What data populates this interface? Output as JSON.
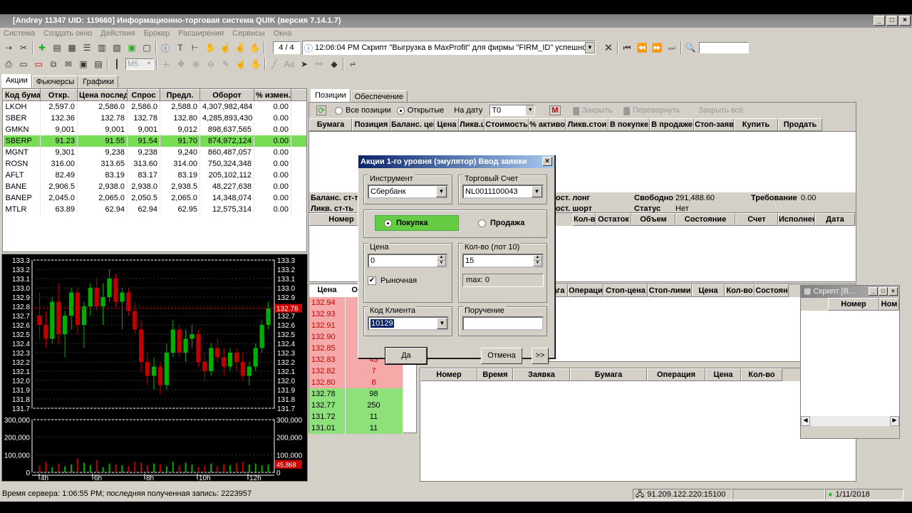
{
  "window": {
    "title": "[Andrey 11347 UID: 119660] Информационно-торговая система QUIK (версия 7.14.1.7)"
  },
  "menu": [
    "Система",
    "Создать окно",
    "Действия",
    "Брокер",
    "Расширения",
    "Сервисы",
    "Окна"
  ],
  "toolbar": {
    "counter": "4 / 4",
    "message": "12:06:04 PM  Скрипт \"Выгрузка в MaxProfit\" для фирмы \"FIRM_ID\" успешно за",
    "interval": "M5",
    "search_value": ""
  },
  "left_tabs": [
    "Акции",
    "Фьючерсы",
    "Графики"
  ],
  "quotes": {
    "headers": [
      "Код бума",
      "Откр.",
      "Цена послед",
      "Спрос",
      "Предл.",
      "Оборот",
      "% измен."
    ],
    "rows": [
      [
        "LKOH",
        "2,597.0",
        "2,586.0",
        "2,586.0",
        "2,588.0",
        "4,307,982,484",
        "0.00"
      ],
      [
        "SBER",
        "132.36",
        "132.78",
        "132.78",
        "132.80",
        "4,285,893,430",
        "0.00"
      ],
      [
        "GMKN",
        "9,001",
        "9,001",
        "9,001",
        "9,012",
        "898,637,565",
        "0.00"
      ],
      [
        "SBERP",
        "91.23",
        "91.55",
        "91.54",
        "91.70",
        "874,972,124",
        "0.00"
      ],
      [
        "MGNT",
        "9,301",
        "9,238",
        "9,238",
        "9,240",
        "860,487,057",
        "0.00"
      ],
      [
        "ROSN",
        "316.00",
        "313.65",
        "313.60",
        "314.00",
        "750,324,348",
        "0.00"
      ],
      [
        "AFLT",
        "82.49",
        "83.19",
        "83.17",
        "83.19",
        "205,102,112",
        "0.00"
      ],
      [
        "BANE",
        "2,906.5",
        "2,938.0",
        "2,938.0",
        "2,938.5",
        "48,227,638",
        "0.00"
      ],
      [
        "BANEP",
        "2,045.0",
        "2,065.0",
        "2,050.5",
        "2,065.0",
        "14,348,074",
        "0.00"
      ],
      [
        "MTLR",
        "63.89",
        "62.94",
        "62.94",
        "62.95",
        "12,575,314",
        "0.00"
      ]
    ],
    "selected_row": 3
  },
  "chart_data": {
    "type": "candlestick",
    "price_ticks": [
      "133.3",
      "133.2",
      "133.1",
      "133.0",
      "132.9",
      "132.8",
      "132.7",
      "132.6",
      "132.5",
      "132.4",
      "132.3",
      "132.2",
      "132.1",
      "132.0",
      "131.9",
      "131.8",
      "131.7"
    ],
    "price_range": [
      131.7,
      133.3
    ],
    "current_price_label": "132.78",
    "volume_ticks": [
      "300,000",
      "200,000",
      "100,000",
      "0"
    ],
    "volume_label": "45,868",
    "time_ticks": [
      "4h",
      "6h",
      "8h",
      "10h",
      "12h"
    ],
    "candles": [
      [
        132.7,
        132.95,
        132.45,
        132.6
      ],
      [
        132.6,
        132.75,
        132.35,
        132.45
      ],
      [
        132.45,
        132.9,
        132.4,
        132.85
      ],
      [
        132.85,
        133.05,
        132.4,
        132.5
      ],
      [
        132.5,
        132.75,
        132.25,
        132.7
      ],
      [
        132.7,
        133.0,
        132.55,
        132.95
      ],
      [
        132.95,
        133.0,
        132.5,
        132.6
      ],
      [
        132.6,
        132.85,
        132.35,
        132.8
      ],
      [
        132.8,
        133.05,
        132.7,
        133.0
      ],
      [
        133.0,
        133.1,
        132.75,
        132.8
      ],
      [
        132.8,
        133.05,
        132.6,
        132.9
      ],
      [
        132.9,
        133.2,
        132.85,
        133.1
      ],
      [
        133.1,
        133.15,
        132.8,
        132.85
      ],
      [
        132.85,
        133.0,
        132.55,
        132.95
      ],
      [
        132.95,
        133.0,
        132.7,
        132.75
      ],
      [
        132.75,
        132.85,
        132.5,
        132.55
      ],
      [
        132.55,
        132.65,
        132.1,
        132.2
      ],
      [
        132.2,
        132.3,
        131.95,
        132.05
      ],
      [
        132.05,
        132.25,
        131.9,
        132.15
      ],
      [
        132.15,
        132.2,
        131.85,
        131.95
      ],
      [
        131.95,
        132.4,
        131.9,
        132.3
      ],
      [
        132.3,
        132.65,
        132.25,
        132.55
      ],
      [
        132.55,
        132.6,
        132.25,
        132.3
      ],
      [
        132.3,
        132.55,
        132.2,
        132.45
      ],
      [
        132.45,
        132.6,
        132.35,
        132.5
      ],
      [
        132.5,
        132.55,
        132.15,
        132.2
      ],
      [
        132.2,
        132.3,
        132.0,
        132.1
      ],
      [
        132.1,
        132.4,
        132.05,
        132.35
      ],
      [
        132.35,
        132.45,
        132.2,
        132.25
      ],
      [
        132.25,
        132.35,
        132.05,
        132.15
      ],
      [
        132.15,
        132.35,
        132.1,
        132.3
      ],
      [
        132.3,
        132.35,
        132.1,
        132.2
      ],
      [
        132.2,
        132.3,
        132.0,
        132.05
      ],
      [
        132.05,
        132.2,
        131.95,
        132.15
      ],
      [
        132.15,
        132.4,
        132.1,
        132.35
      ],
      [
        132.35,
        132.65,
        132.3,
        132.6
      ],
      [
        132.6,
        132.85,
        132.55,
        132.78
      ]
    ],
    "volumes": [
      40000,
      60000,
      30000,
      50000,
      35000,
      45000,
      80000,
      55000,
      40000,
      70000,
      30000,
      50000,
      45000,
      40000,
      35000,
      60000,
      55000,
      40000,
      50000,
      45000,
      35000,
      60000,
      40000,
      55000,
      45000,
      30000,
      40000,
      50000,
      35000,
      45000,
      40000,
      55000,
      60000,
      45000,
      50000,
      40000,
      45868
    ]
  },
  "right_tabs": [
    "Позиции",
    "Обеспечение"
  ],
  "positions": {
    "filter": {
      "all_label": "Все позиции",
      "open_label": "Открытые",
      "date_label": "На дату",
      "date_value": "T0",
      "close_label": "Закрыть",
      "flip_label": "Перевернуть",
      "close_all_label": "Закрыть всё"
    },
    "headers": [
      "Бумага",
      "Позиция",
      "Баланс. цен",
      "Цена",
      "Ликв.ц",
      "Стоимость",
      "% активов",
      "Ликв.стои",
      "В покупке",
      "В продаже",
      "Стоп-заяв",
      "Купить",
      "Продать"
    ],
    "summary": {
      "balance_label": "Баланс. ст-ть",
      "liq_label": "Ликв. ст-ть",
      "long_label": "ост. лонг",
      "short_label": "ост. шорт",
      "free_label": "Свободно",
      "free_value": "291,488.60",
      "status_label": "Статус",
      "status_value": "Нет",
      "req_label": "Требование",
      "req_value": "0.00"
    }
  },
  "orders": {
    "headers": [
      "Номер",
      "Кол-во",
      "Остаток",
      "Объем",
      "Состояние",
      "Счет",
      "Исполнен",
      "Дата"
    ]
  },
  "orderbook": {
    "headers": [
      "Цена",
      "Об"
    ],
    "asks": [
      [
        "132.94",
        ""
      ],
      [
        "132.93",
        ""
      ],
      [
        "132.91",
        ""
      ],
      [
        "132.90",
        ""
      ],
      [
        "132.85",
        ""
      ],
      [
        "132.83",
        "43"
      ],
      [
        "132.82",
        "7"
      ],
      [
        "132.80",
        "8"
      ]
    ],
    "bids": [
      [
        "132.78",
        "98"
      ],
      [
        "132.77",
        "250"
      ],
      [
        "131.72",
        "11"
      ],
      [
        "131.01",
        "11"
      ]
    ]
  },
  "stop_orders": {
    "headers": [
      "ага",
      "Операци",
      "Стоп-цена",
      "Стоп-лими",
      "Цена",
      "Кол-во",
      "Состоян"
    ]
  },
  "trades": {
    "headers": [
      "Номер",
      "Время",
      "Заявка",
      "Бумага",
      "Операция",
      "Цена",
      "Кол-во"
    ]
  },
  "script_window": {
    "title": "Скрипт [В...",
    "headers": [
      "Номер",
      "Ном"
    ]
  },
  "dialog": {
    "title": "Акции 1-го уровня (эмулятор) Ввод заявки",
    "instrument_label": "Инструмент",
    "instrument_value": "Сбербанк",
    "account_label": "Торговый Счет",
    "account_value": "NL0011100043",
    "buy_label": "Покупка",
    "sell_label": "Продажа",
    "price_label": "Цена",
    "price_value": "0",
    "market_label": "Рыночная",
    "qty_label": "Кол-во (лот 10)",
    "qty_value": "15",
    "max_label": "max: 0",
    "client_label": "Код Клиента",
    "client_value": "10129",
    "order_label": "Поручение",
    "order_value": "",
    "ok_label": "Да",
    "cancel_label": "Отмена",
    "more_label": ">>"
  },
  "status": {
    "server_time": "Время сервера: 1:06:55 PM; последняя полученная запись: 2223957",
    "connection": "91.209.122.220:15100",
    "date": "1/11/2018"
  },
  "colors": {
    "selected_row": "#77dd55",
    "ask": "#f5a9a9",
    "bid": "#8ee07a",
    "bull": "#00b000",
    "bear": "#c00000",
    "buy_button": "#66cc44"
  }
}
